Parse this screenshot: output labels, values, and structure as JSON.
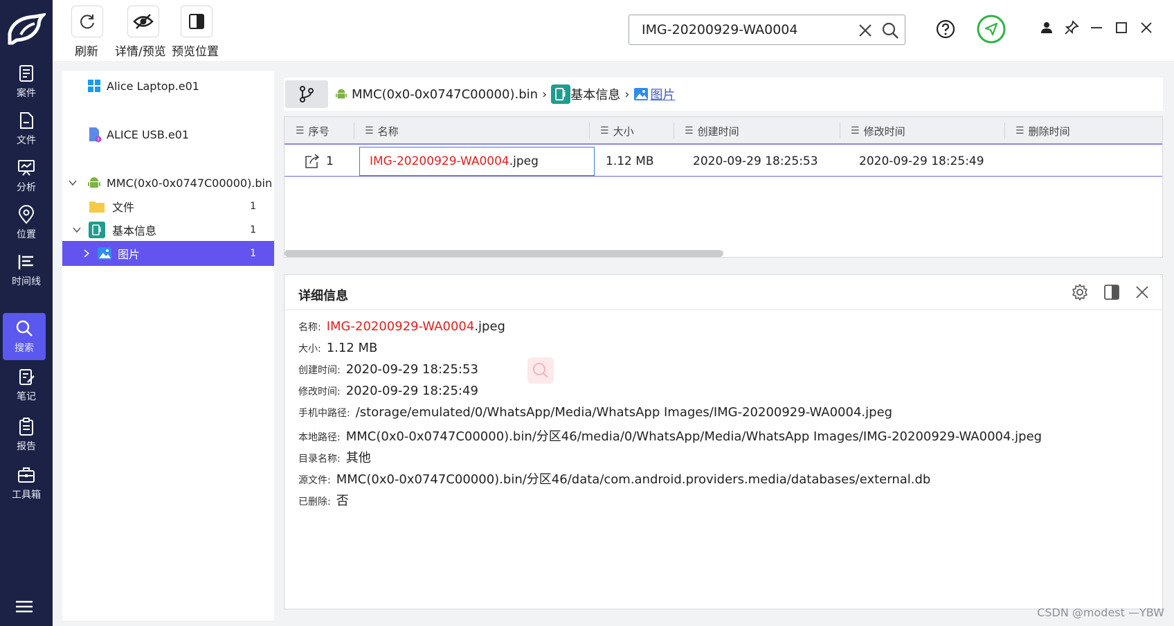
{
  "sidebar": {
    "items": [
      {
        "label": "案件",
        "icon": "case-icon"
      },
      {
        "label": "文件",
        "icon": "file-icon"
      },
      {
        "label": "分析",
        "icon": "analysis-icon"
      },
      {
        "label": "位置",
        "icon": "location-icon"
      },
      {
        "label": "时间线",
        "icon": "timeline-icon"
      },
      {
        "label": "搜索",
        "icon": "search-icon",
        "active": true
      },
      {
        "label": "笔记",
        "icon": "notes-icon"
      },
      {
        "label": "报告",
        "icon": "report-icon"
      },
      {
        "label": "工具箱",
        "icon": "toolbox-icon"
      }
    ],
    "accent": "#5b58f0",
    "background": "#1b2246"
  },
  "toolbar": {
    "refresh_label": "刷新",
    "detail_label": "详情/预览",
    "preview_pos_label": "预览位置"
  },
  "search": {
    "value": "IMG-20200929-WA0004"
  },
  "tree": {
    "items": [
      {
        "label": "Alice  Laptop.e01",
        "icon": "windows-icon"
      },
      {
        "label": "ALICE  USB.e01",
        "icon": "usb-drive-icon"
      },
      {
        "label": "MMC(0x0-0x0747C00000).bin",
        "icon": "android-icon",
        "expanded": true
      },
      {
        "label": "文件",
        "count": "1",
        "icon": "folder-icon"
      },
      {
        "label": "基本信息",
        "count": "1",
        "icon": "basic-info-icon",
        "expanded": true
      },
      {
        "label": "图片",
        "count": "1",
        "icon": "image-icon",
        "selected": true
      }
    ]
  },
  "breadcrumb": {
    "device": "MMC(0x0-0x0747C00000).bin",
    "section": "基本信息",
    "current": "图片",
    "separator": "›"
  },
  "table": {
    "columns": [
      "序号",
      "名称",
      "大小",
      "创建时间",
      "修改时间",
      "删除时间"
    ],
    "rows": [
      {
        "index": "1",
        "name_highlight": "IMG-20200929-WA0004",
        "name_rest": ".jpeg",
        "size": "1.12 MB",
        "created": "2020-09-29 18:25:53",
        "modified": "2020-09-29 18:25:49",
        "deleted": ""
      }
    ]
  },
  "detail": {
    "title": "详细信息",
    "fields": [
      {
        "key": "名称:",
        "value_highlight": "IMG-20200929-WA0004",
        "value": ".jpeg"
      },
      {
        "key": "大小:",
        "value": "1.12 MB"
      },
      {
        "key": "创建时间:",
        "value": "2020-09-29 18:25:53"
      },
      {
        "key": "修改时间:",
        "value": "2020-09-29 18:25:49"
      },
      {
        "key": "手机中路径:",
        "value": "/storage/emulated/0/WhatsApp/Media/WhatsApp Images/IMG-20200929-WA0004.jpeg"
      },
      {
        "key": "本地路径:",
        "value": "MMC(0x0-0x0747C00000).bin/分区46/media/0/WhatsApp/Media/WhatsApp Images/IMG-20200929-WA0004.jpeg"
      },
      {
        "key": "目录名称:",
        "value": "其他"
      },
      {
        "key": "源文件:",
        "value": "MMC(0x0-0x0747C00000).bin/分区46/data/com.android.providers.media/databases/external.db"
      },
      {
        "key": "已删除:",
        "value": "否"
      }
    ]
  },
  "watermark": "CSDN @modest —YBW",
  "colors": {
    "highlight": "#e02020",
    "selected_row": "#6354f0",
    "link": "#3b5bd6",
    "status_ok": "#2fb344"
  }
}
